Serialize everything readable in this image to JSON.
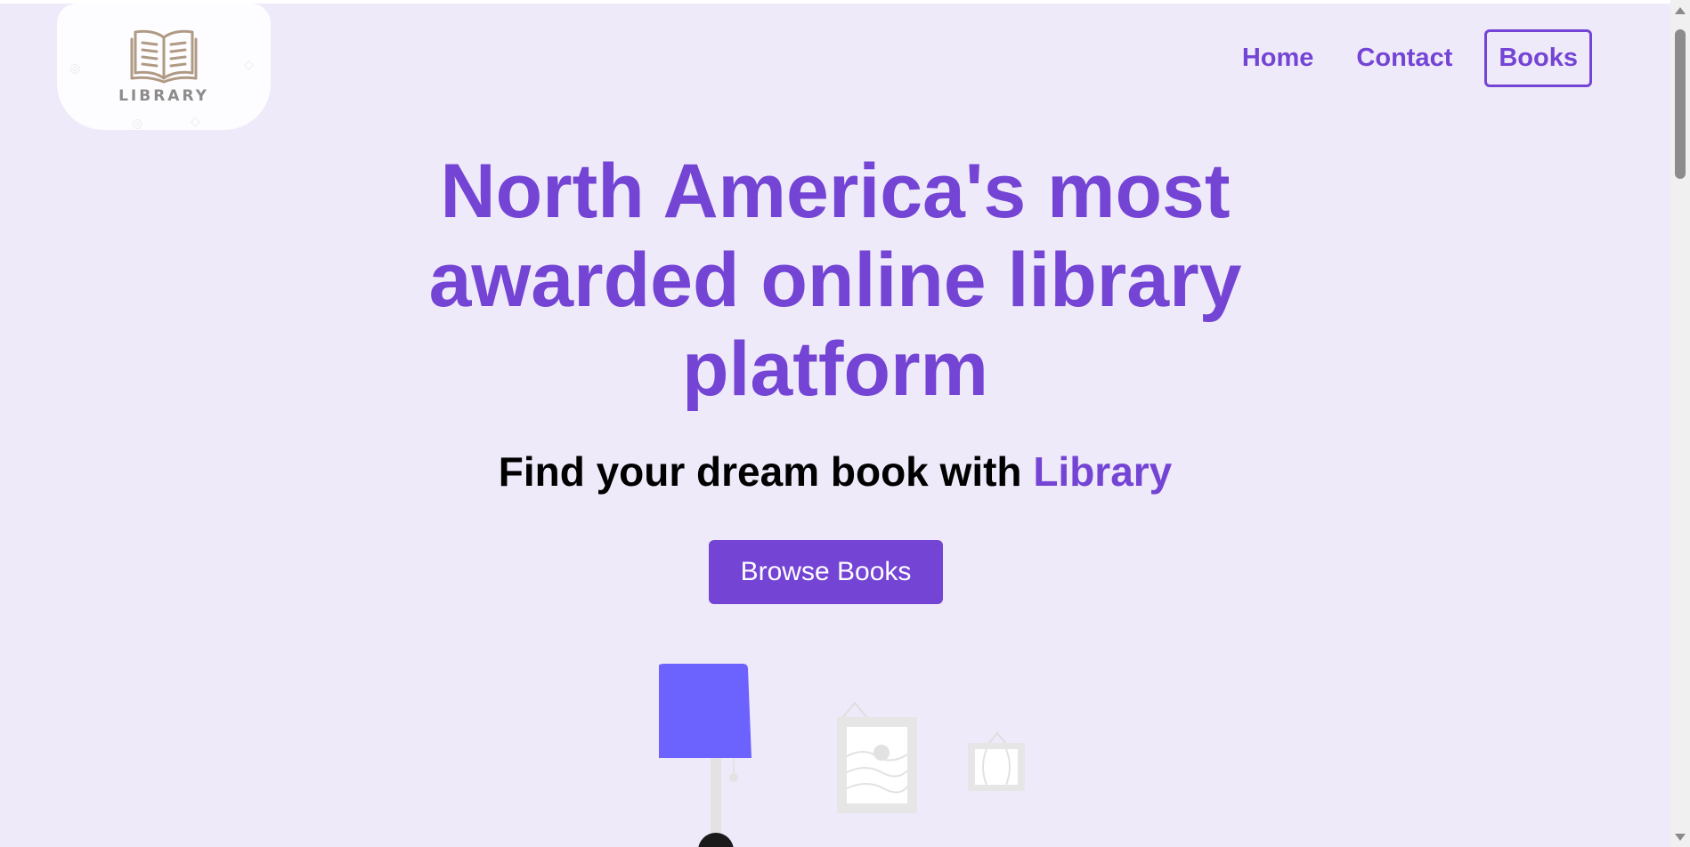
{
  "logo": {
    "text": "LIBRARY",
    "icon": "open-book-icon"
  },
  "nav": {
    "links": [
      {
        "label": "Home"
      },
      {
        "label": "Contact"
      },
      {
        "label": "Books"
      }
    ]
  },
  "hero": {
    "title_line1": "North America's most",
    "title_line2": "awarded online library",
    "title_line3": "platform",
    "subtitle_prefix": "Find your dream book with ",
    "subtitle_accent": "Library",
    "cta_label": "Browse Books"
  },
  "colors": {
    "accent": "#7444d5",
    "background": "#efeaf9",
    "lamp": "#6c63ff"
  }
}
